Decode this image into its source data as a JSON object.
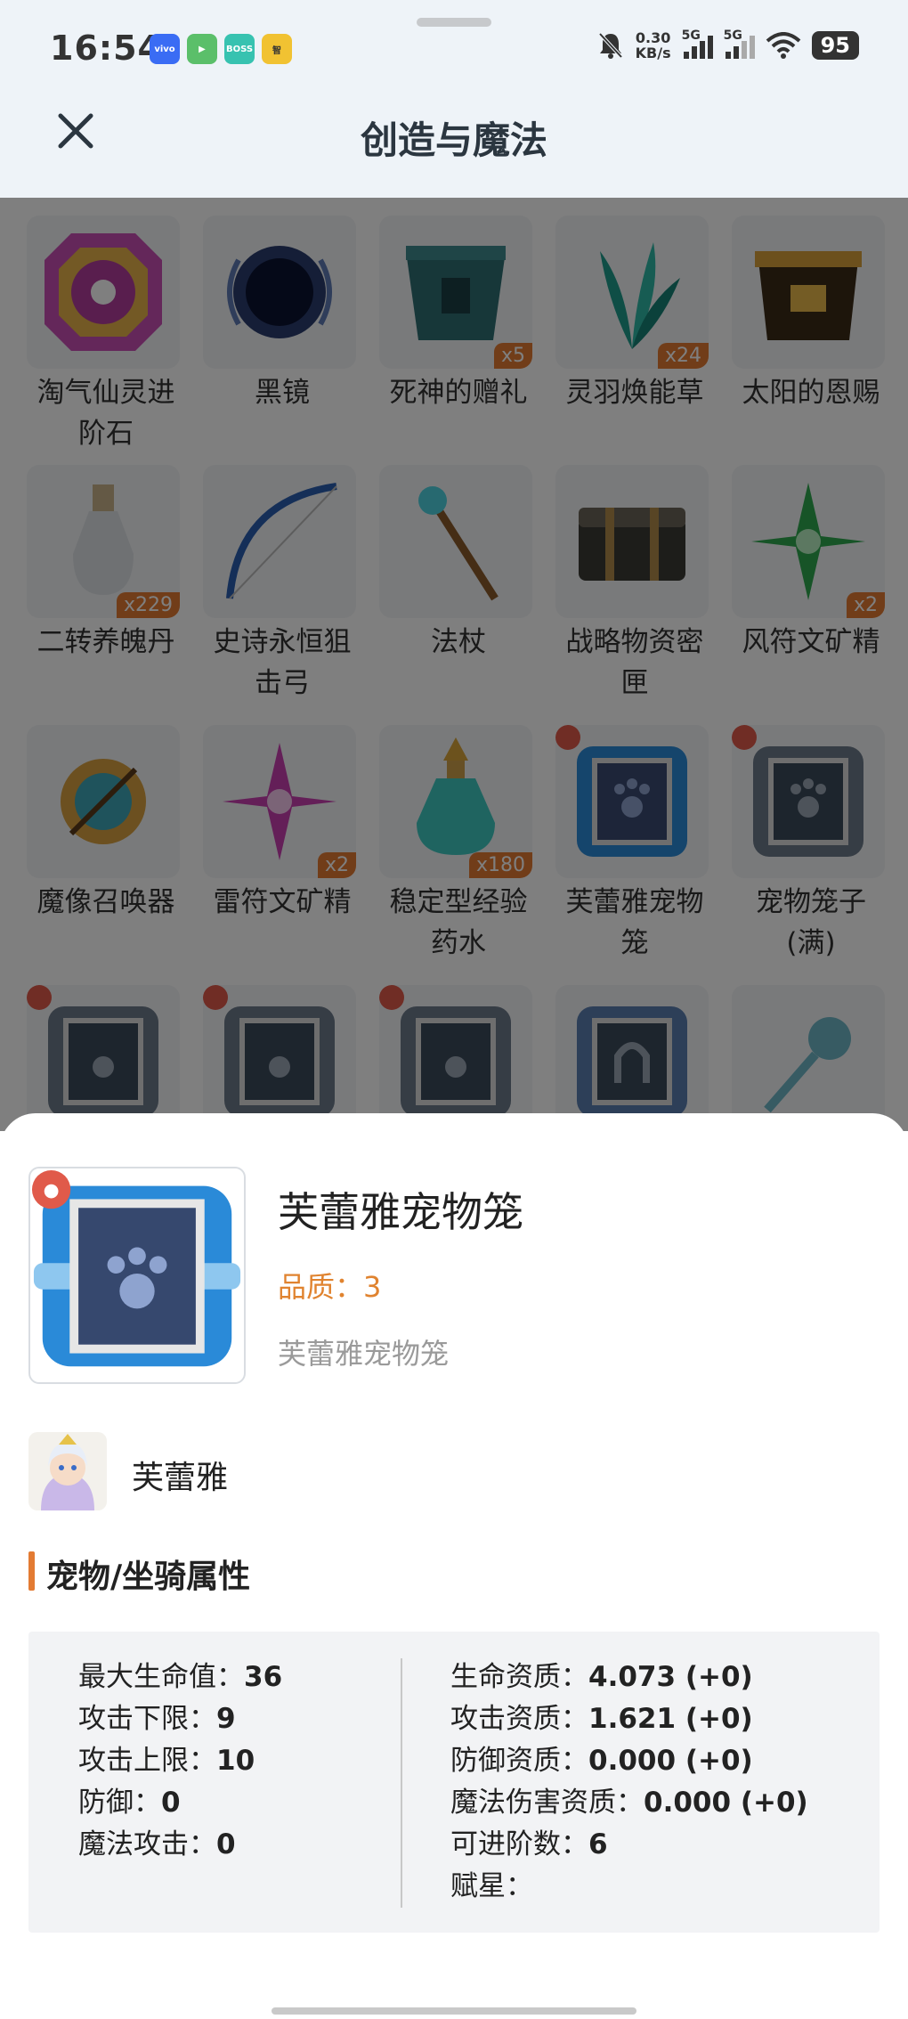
{
  "status_bar": {
    "time": "16:54",
    "app_icons": [
      {
        "label": "vivo",
        "color": "#3a6cf4"
      },
      {
        "label": "",
        "color": "#5bbf6a"
      },
      {
        "label": "BOSS",
        "color": "#37c2b0"
      },
      {
        "label": "智",
        "color": "#f1c232"
      }
    ],
    "net_speed_value": "0.30",
    "net_speed_unit": "KB/s",
    "sim1": "5G",
    "sim2": "5G",
    "battery": "95"
  },
  "header": {
    "title": "创造与魔法",
    "close_icon": "close-icon"
  },
  "grid": {
    "items": [
      {
        "name_line1": "淘气仙灵进",
        "name_line2": "阶石",
        "qty": "",
        "icon": "gem-icon"
      },
      {
        "name_line1": "黑镜",
        "name_line2": "",
        "qty": "",
        "icon": "mirror-icon"
      },
      {
        "name_line1": "死神的赠礼",
        "name_line2": "",
        "qty": "x5",
        "icon": "chest-icon"
      },
      {
        "name_line1": "灵羽焕能草",
        "name_line2": "",
        "qty": "x24",
        "icon": "herb-icon"
      },
      {
        "name_line1": "太阳的恩赐",
        "name_line2": "",
        "qty": "",
        "icon": "sun-chest-icon"
      },
      {
        "name_line1": "二转养魄丹",
        "name_line2": "",
        "qty": "x229",
        "icon": "bottle-icon"
      },
      {
        "name_line1": "史诗永恒狙",
        "name_line2": "击弓",
        "qty": "",
        "icon": "bow-icon"
      },
      {
        "name_line1": "法杖",
        "name_line2": "",
        "qty": "",
        "icon": "staff-icon"
      },
      {
        "name_line1": "战略物资密",
        "name_line2": "匣",
        "qty": "",
        "icon": "crate-icon"
      },
      {
        "name_line1": "风符文矿精",
        "name_line2": "",
        "qty": "x2",
        "icon": "green-crystal-icon"
      },
      {
        "name_line1": "魔像召唤器",
        "name_line2": "",
        "qty": "",
        "icon": "compass-icon"
      },
      {
        "name_line1": "雷符文矿精",
        "name_line2": "",
        "qty": "x2",
        "icon": "pink-crystal-icon"
      },
      {
        "name_line1": "稳定型经验",
        "name_line2": "药水",
        "qty": "x180",
        "icon": "potion-icon"
      },
      {
        "name_line1": "芙蕾雅宠物",
        "name_line2": "笼",
        "qty": "",
        "icon": "pet-cage-blue-icon"
      },
      {
        "name_line1": "宠物笼子",
        "name_line2": "(满)",
        "qty": "",
        "icon": "pet-cage-gray-icon"
      },
      {
        "name_line1": "",
        "name_line2": "",
        "qty": "",
        "icon": "pet-cage-gray-icon"
      },
      {
        "name_line1": "",
        "name_line2": "",
        "qty": "",
        "icon": "pet-cage-gray-icon"
      },
      {
        "name_line1": "",
        "name_line2": "",
        "qty": "",
        "icon": "pet-cage-gray-icon"
      },
      {
        "name_line1": "",
        "name_line2": "",
        "qty": "",
        "icon": "horseshoe-cage-icon"
      },
      {
        "name_line1": "",
        "name_line2": "",
        "qty": "",
        "icon": "key-icon"
      }
    ]
  },
  "detail": {
    "name": "芙蕾雅宠物笼",
    "quality_label": "品质：",
    "quality_value": "3",
    "description": "芙蕾雅宠物笼",
    "pet_name": "芙蕾雅",
    "section_title": "宠物/坐骑属性",
    "left_attrs": [
      {
        "label": "最大生命值：",
        "value": "36"
      },
      {
        "label": "攻击下限：",
        "value": "9"
      },
      {
        "label": "攻击上限：",
        "value": "10"
      },
      {
        "label": "防御：",
        "value": "0"
      },
      {
        "label": "魔法攻击：",
        "value": "0"
      }
    ],
    "right_attrs": [
      {
        "label": "生命资质：",
        "value": "4.073 (+0)"
      },
      {
        "label": "攻击资质：",
        "value": "1.621 (+0)"
      },
      {
        "label": "防御资质：",
        "value": "0.000 (+0)"
      },
      {
        "label": "魔法伤害资质：",
        "value": "0.000 (+0)"
      },
      {
        "label": "可进阶数：",
        "value": "6"
      },
      {
        "label": "赋星：",
        "value": ""
      }
    ]
  },
  "colors": {
    "accent": "#e37b33",
    "header_bg": "#eef3f8",
    "panel_bg": "#f2f3f5"
  }
}
